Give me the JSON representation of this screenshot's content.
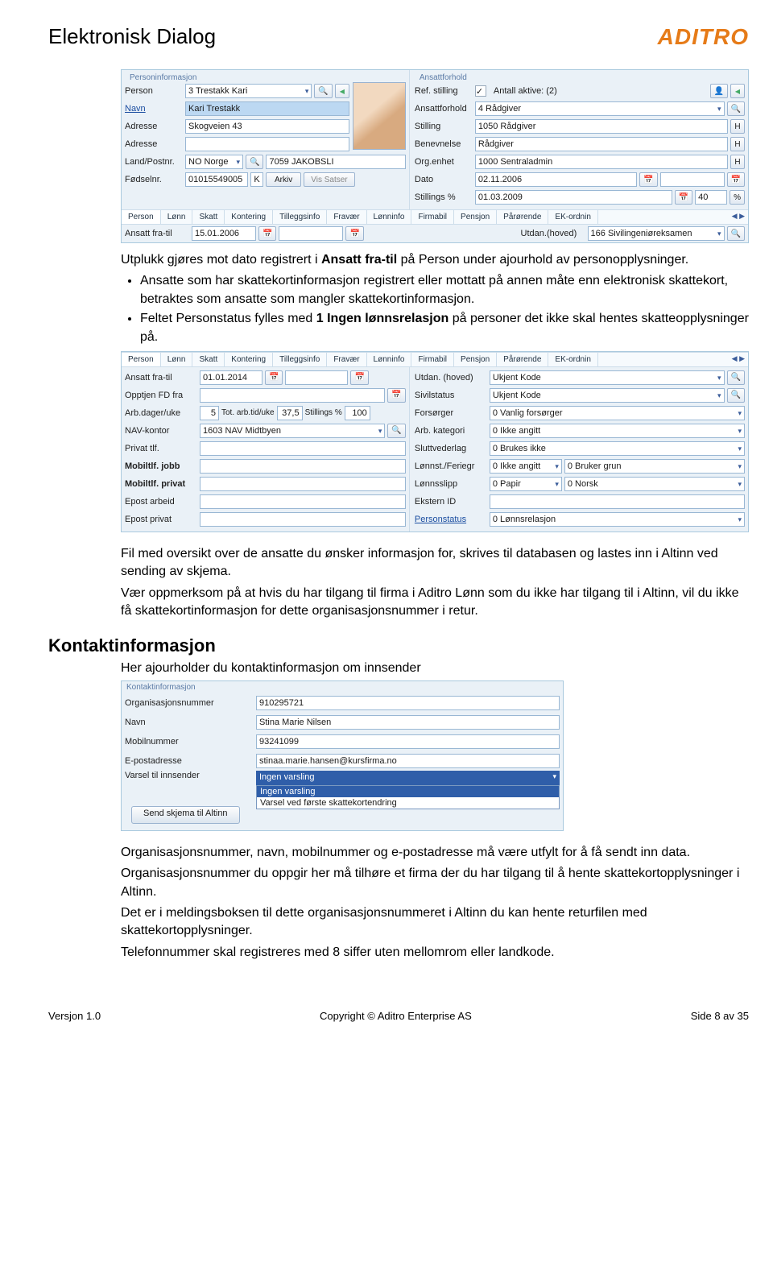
{
  "doc": {
    "title": "Elektronisk Dialog",
    "logo": "ADITRO"
  },
  "panel1": {
    "left": {
      "section": "Personinformasjon",
      "person_lbl": "Person",
      "person_val": "3 Trestakk Kari",
      "navn_lbl": "Navn",
      "navn_val": "Kari Trestakk",
      "adresse_lbl": "Adresse",
      "adresse_val": "Skogveien 43",
      "adresse2_lbl": "Adresse",
      "adresse2_val": "",
      "land_lbl": "Land/Postnr.",
      "land_val": "NO Norge",
      "postnr_val": "7059 JAKOBSLI",
      "fnr_lbl": "Fødselnr.",
      "fnr_val": "01015549005",
      "fnr_k": "K",
      "arkiv_btn": "Arkiv",
      "vis_btn": "Vis Satser"
    },
    "right": {
      "section": "Ansattforhold",
      "ref_lbl": "Ref. stilling",
      "aktive_lbl": "Antall aktive: (2)",
      "forhold_lbl": "Ansattforhold",
      "forhold_val": "4 Rådgiver",
      "stilling_lbl": "Stilling",
      "stilling_val": "1050 Rådgiver",
      "benev_lbl": "Benevnelse",
      "benev_val": "Rådgiver",
      "org_lbl": "Org.enhet",
      "org_val": "1000 Sentraladmin",
      "dato_lbl": "Dato",
      "dato_val": "02.11.2006",
      "spct_lbl": "Stillings %",
      "spct_date": "01.03.2009",
      "spct_val": "40",
      "h": "H"
    },
    "tabs": [
      "Person",
      "Lønn",
      "Skatt",
      "Kontering",
      "Tilleggsinfo",
      "Fravær",
      "Lønninfo",
      "Firmabil",
      "Pensjon",
      "Pårørende",
      "EK-ordnin"
    ],
    "sub": {
      "ansatt_lbl": "Ansatt fra-til",
      "ansatt_val": "15.01.2006",
      "utdan_lbl": "Utdan.(hoved)",
      "utdan_val": "166 Sivilingeniøreksamen"
    }
  },
  "body1": {
    "p1a": "Utplukk gjøres mot dato registrert i ",
    "p1b": "Ansatt fra-til",
    "p1c": " på Person under ajourhold av personopplysninger.",
    "li1": "Ansatte som har skattekortinformasjon registrert eller mottatt på annen måte enn elektronisk skattekort, betraktes som ansatte som mangler skattekortinformasjon.",
    "li2a": "Feltet Personstatus fylles med ",
    "li2b": "1 Ingen lønnsrelasjon",
    "li2c": " på personer det ikke skal hentes skatteopplysninger på."
  },
  "panel2": {
    "tabs": [
      "Person",
      "Lønn",
      "Skatt",
      "Kontering",
      "Tilleggsinfo",
      "Fravær",
      "Lønninfo",
      "Firmabil",
      "Pensjon",
      "Pårørende",
      "EK-ordnin"
    ],
    "left": {
      "ansatt_lbl": "Ansatt fra-til",
      "ansatt_val": "01.01.2014",
      "opptj_lbl": "Opptjen FD fra",
      "opptj_val": "",
      "arbdag_lbl": "Arb.dager/uke",
      "arbdag_val": "5",
      "tot_lbl": "Tot. arb.tid/uke",
      "tot_val": "37,5",
      "spct_lbl": "Stillings %",
      "spct_val": "100",
      "nav_lbl": "NAV-kontor",
      "nav_val": "1603 NAV Midtbyen",
      "priv_lbl": "Privat tlf.",
      "priv_val": "",
      "mobj_lbl": "Mobiltlf. jobb",
      "mobj_val": "",
      "mobp_lbl": "Mobiltlf. privat",
      "mobp_val": "",
      "eposta_lbl": "Epost arbeid",
      "eposta_val": "",
      "epostp_lbl": "Epost privat",
      "epostp_val": ""
    },
    "right": {
      "utdan_lbl": "Utdan. (hoved)",
      "utdan_val": "Ukjent Kode",
      "sivil_lbl": "Sivilstatus",
      "sivil_val": "Ukjent Kode",
      "fors_lbl": "Forsørger",
      "fors_val": "0 Vanlig forsørger",
      "arbk_lbl": "Arb. kategori",
      "arbk_val": "0 Ikke angitt",
      "slutt_lbl": "Sluttvederlag",
      "slutt_val": "0 Brukes ikke",
      "lonst_lbl": "Lønnst./Feriegr",
      "lonst_val": "0 Ikke angitt",
      "lonst2_val": "0 Bruker grun",
      "lslip_lbl": "Lønnsslipp",
      "lslip_val": "0 Papir",
      "lslip2_val": "0 Norsk",
      "ekst_lbl": "Ekstern ID",
      "ekst_val": "",
      "pstat_lbl": "Personstatus",
      "pstat_val": "0 Lønnsrelasjon"
    }
  },
  "body2": {
    "p1": "Fil med oversikt over de ansatte du ønsker informasjon for, skrives til databasen og lastes inn i Altinn ved sending av skjema.",
    "p2": "Vær oppmerksom på at hvis du har tilgang til firma i Aditro Lønn som du ikke har tilgang til i Altinn, vil du ikke få skattekortinformasjon for dette organisasjonsnummer i retur.",
    "h": "Kontaktinformasjon",
    "p3": "Her ajourholder du kontaktinformasjon om innsender"
  },
  "panel3": {
    "section": "Kontaktinformasjon",
    "org_lbl": "Organisasjonsnummer",
    "org_val": "910295721",
    "navn_lbl": "Navn",
    "navn_val": "Stina Marie Nilsen",
    "mob_lbl": "Mobilnummer",
    "mob_val": "93241099",
    "epost_lbl": "E-postadresse",
    "epost_val": "stinaa.marie.hansen@kursfirma.no",
    "varsel_lbl": "Varsel til innsender",
    "varsel_sel": "Ingen varsling",
    "varsel_opt1": "Ingen varsling",
    "varsel_opt2": "Varsel ved første skattekortendring",
    "send_btn": "Send skjema til Altinn"
  },
  "body3": {
    "p1": "Organisasjonsnummer, navn, mobilnummer og e-postadresse må være utfylt for å få sendt inn data.",
    "p2": "Organisasjonsnummer du oppgir her må tilhøre et firma der du har tilgang til å hente skattekortopplysninger i Altinn.",
    "p3": "Det er i meldingsboksen til dette organisasjonsnummeret i Altinn du kan hente returfilen med skattekortopplysninger.",
    "p4": "Telefonnummer skal registreres med 8 siffer uten mellomrom eller landkode."
  },
  "footer": {
    "left": "Versjon 1.0",
    "mid": "Copyright © Aditro Enterprise AS",
    "right": "Side 8 av 35"
  }
}
